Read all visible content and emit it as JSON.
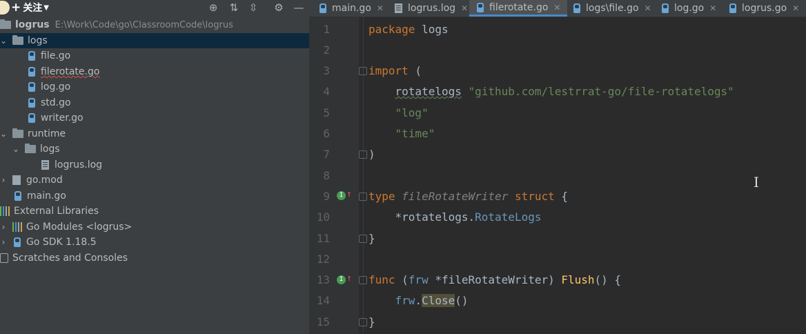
{
  "header": {
    "follow_label": "关注",
    "follow_plus": "+"
  },
  "project": {
    "root_name": "logrus",
    "root_path": "E:\\Work\\Code\\go\\ClassroomCode\\logrus",
    "items": [
      {
        "label": "logs"
      },
      {
        "label": "file.go"
      },
      {
        "label": "filerotate.go"
      },
      {
        "label": "log.go"
      },
      {
        "label": "std.go"
      },
      {
        "label": "writer.go"
      },
      {
        "label": "runtime"
      },
      {
        "label": "logs"
      },
      {
        "label": "logrus.log"
      },
      {
        "label": "go.mod"
      },
      {
        "label": "main.go"
      },
      {
        "label": "External Libraries"
      },
      {
        "label": "Go Modules <logrus>"
      },
      {
        "label": "Go SDK 1.18.5"
      },
      {
        "label": "Scratches and Consoles"
      }
    ]
  },
  "tabs": [
    {
      "label": "main.go"
    },
    {
      "label": "logrus.log"
    },
    {
      "label": "filerotate.go"
    },
    {
      "label": "logs\\file.go"
    },
    {
      "label": "log.go"
    },
    {
      "label": "logrus.go"
    }
  ],
  "editor": {
    "line_numbers": [
      "1",
      "2",
      "3",
      "4",
      "5",
      "6",
      "7",
      "8",
      "9",
      "10",
      "11",
      "12",
      "13",
      "14",
      "15"
    ],
    "code": {
      "l1_kw": "package",
      "l1_name": " logs",
      "l3_kw": "import",
      "l3_paren": " (",
      "l4_alias": "rotatelogs",
      "l4_str": "\"github.com/lestrrat-go/file-rotatelogs\"",
      "l5_str": "\"log\"",
      "l6_str": "\"time\"",
      "l7_paren": ")",
      "l9_kw": "type",
      "l9_name": "fileRotateWriter",
      "l9_kw2": "struct",
      "l9_brace": " {",
      "l10_star": "*",
      "l10_pkg": "rotatelogs",
      "l10_dot": ".",
      "l10_type": "RotateLogs",
      "l11_brace": "}",
      "l13_kw": "func",
      "l13_open": " (",
      "l13_recv": "frw",
      "l13_mid": " *fileRotateWriter) ",
      "l13_fn": "Flush",
      "l13_end": "() {",
      "l14_recv": "frw",
      "l14_dot": ".",
      "l14_call": "Close",
      "l14_end": "()",
      "l15_brace": "}"
    }
  },
  "cursor_glyph": "I"
}
